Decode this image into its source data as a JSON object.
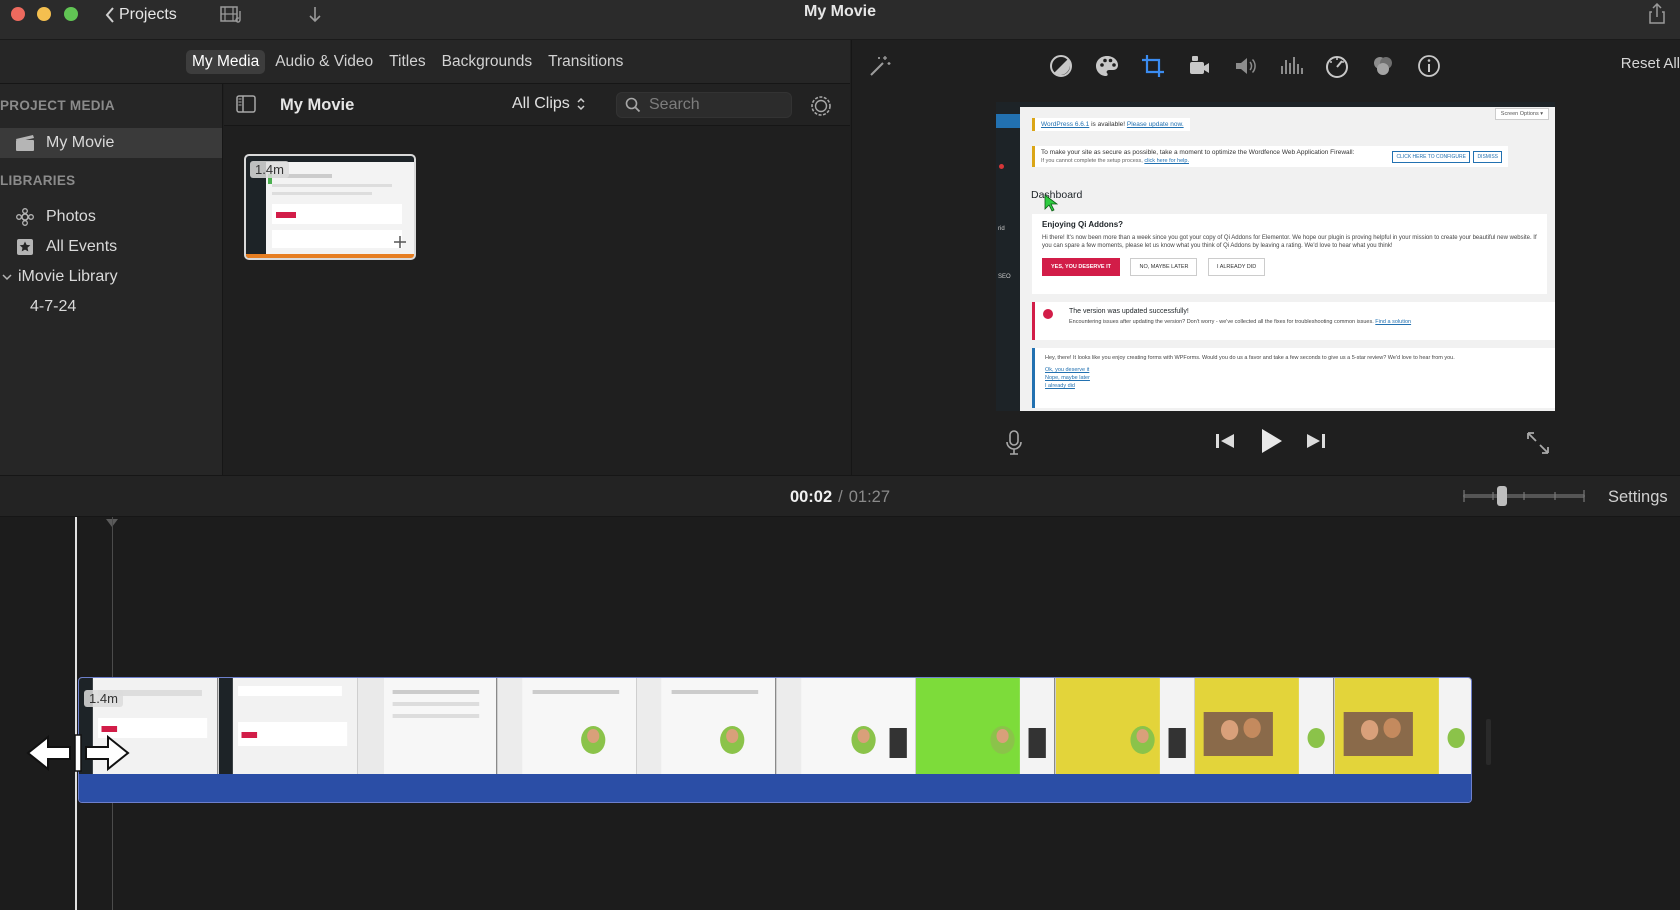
{
  "window": {
    "title": "My Movie",
    "back_label": "Projects"
  },
  "tabs": [
    {
      "label": "My Media",
      "active": true
    },
    {
      "label": "Audio & Video",
      "active": false
    },
    {
      "label": "Titles",
      "active": false
    },
    {
      "label": "Backgrounds",
      "active": false
    },
    {
      "label": "Transitions",
      "active": false
    }
  ],
  "sidebar": {
    "project_media_heading": "PROJECT MEDIA",
    "project_item": "My Movie",
    "libraries_heading": "LIBRARIES",
    "photos": "Photos",
    "all_events": "All Events",
    "library": "iMovie Library",
    "event": "4-7-24"
  },
  "browser": {
    "title": "My Movie",
    "filter": "All Clips",
    "search_placeholder": "Search",
    "clip_duration": "1.4m"
  },
  "viewer": {
    "reset_all": "Reset All",
    "preview": {
      "notice1_text": "is available!",
      "notice1_version": "WordPress 6.6.1",
      "notice1_link": "Please update now.",
      "notice2_text": "To make your site as secure as possible, take a moment to optimize the Wordfence Web Application Firewall:",
      "notice2_sub": "If you cannot complete the setup process,",
      "notice2_sub_link": "click here for help.",
      "notice2_btn1": "CLICK HERE TO CONFIGURE",
      "notice2_btn2": "DISMISS",
      "screen_options": "Screen Options ▾",
      "dashboard": "Dashboard",
      "side_rid": "rid",
      "side_seo": "SEO",
      "card_title": "Enjoying Qi Addons?",
      "card_body": "Hi there! It's now been more than a week since you got your copy of Qi Addons for Elementor. We hope our plugin is proving helpful in your mission to create your beautiful new website. If you can spare a few moments, please let us know what you think of Qi Addons by leaving a rating. We'd love to hear what you think!",
      "card_btn_yes": "YES, YOU DESERVE IT",
      "card_btn_later": "NO, MAYBE LATER",
      "card_btn_did": "I ALREADY DID",
      "update_title": "The version was updated successfully!",
      "update_body": "Encountering issues after updating the version? Don't worry - we've collected all the fixes for troubleshooting common issues.",
      "update_link": "Find a solution",
      "wpforms_body": "Hey, there! It looks like you enjoy creating forms with WPForms. Would you do us a favor and take a few seconds to give us a 5-star review? We'd love to hear from you.",
      "wpforms_link1": "Ok, you deserve it",
      "wpforms_link2": "Nope, maybe later",
      "wpforms_link3": "I already did"
    }
  },
  "timeline": {
    "current_time": "00:02",
    "separator": "/",
    "total_time": "01:27",
    "settings": "Settings",
    "clip_duration": "1.4m"
  },
  "colors": {
    "audio_band": "#2b4ea6",
    "clip_bar": "#e67e22",
    "wp_red_button": "#d21d48"
  }
}
